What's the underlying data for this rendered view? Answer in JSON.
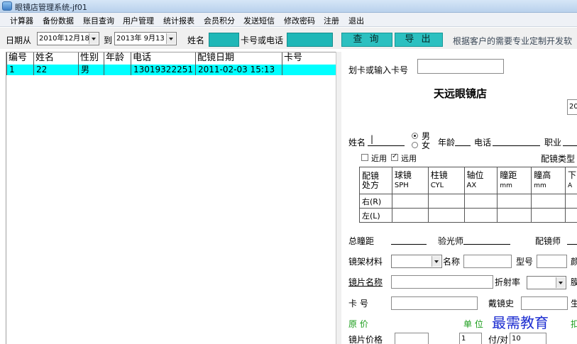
{
  "window": {
    "title": "眼镜店管理系统-jf01"
  },
  "menu": [
    "计算器",
    "备份数据",
    "账目查询",
    "用户管理",
    "统计报表",
    "会员积分",
    "发送短信",
    "修改密码",
    "注册",
    "退出"
  ],
  "toolbar": {
    "date_from_label": "日期从",
    "date_from_value": "2010年12月18",
    "date_to_label": "到",
    "date_to_value": "2013年 9月13",
    "name_label": "姓名",
    "card_phone_label": "卡号或电话",
    "query_button": "查 询",
    "export_button": "导 出",
    "hint": "根据客户的需要专业定制开发软"
  },
  "grid": {
    "columns": [
      "编号",
      "姓名",
      "性别",
      "年龄",
      "电话",
      "配镜日期",
      "卡号"
    ],
    "rows": [
      [
        "1",
        "22",
        "男",
        "",
        "13019322251",
        "2011-02-03 15:13",
        ""
      ]
    ]
  },
  "form": {
    "swipe_label": "划卡或输入卡号",
    "shop_name": "天远眼镜店",
    "date_stub": "20",
    "name_label": "姓名",
    "name_value": "|",
    "gender_male": "男",
    "gender_female": "女",
    "age_label": "年龄",
    "phone_label": "电话",
    "job_label": "职业",
    "near_label": "近用",
    "far_label": "远用",
    "lens_type_label": "配镜类型",
    "rx_headers": [
      [
        "配镜",
        "处方"
      ],
      [
        "球镜",
        "SPH"
      ],
      [
        "柱镜",
        "CYL"
      ],
      [
        "轴位",
        "AX"
      ],
      [
        "瞳距",
        "mm"
      ],
      [
        "瞳高",
        "mm"
      ],
      [
        "下",
        "A"
      ]
    ],
    "rx_right": "右(R)",
    "rx_left": "左(L)",
    "total_pd_label": "总瞳距",
    "optometrist_label": "验光师",
    "fitter_label": "配镜师",
    "frame_material_label": "镜架材料",
    "frame_name_label": "名称",
    "model_label": "型号",
    "color_stub": "颜",
    "lens_name_label": "镜片名称",
    "refractive_label": "折射率",
    "edge_stub": "膜",
    "card_no_label": "卡    号",
    "wear_history_label": "戴镜史",
    "birth_stub": "生",
    "original_price_label": "原    价",
    "unit_label": "单 位",
    "discount_stub": "扣",
    "lens_price_label": "镜片价格",
    "qty_value": "1",
    "per_pair_label": "付/对",
    "per_pair_value": "10",
    "watermark": "最需教育"
  },
  "colors": {
    "teal": "#1fb7b7",
    "row_highlight": "#00ffff",
    "green_text": "#1a9c1a"
  }
}
